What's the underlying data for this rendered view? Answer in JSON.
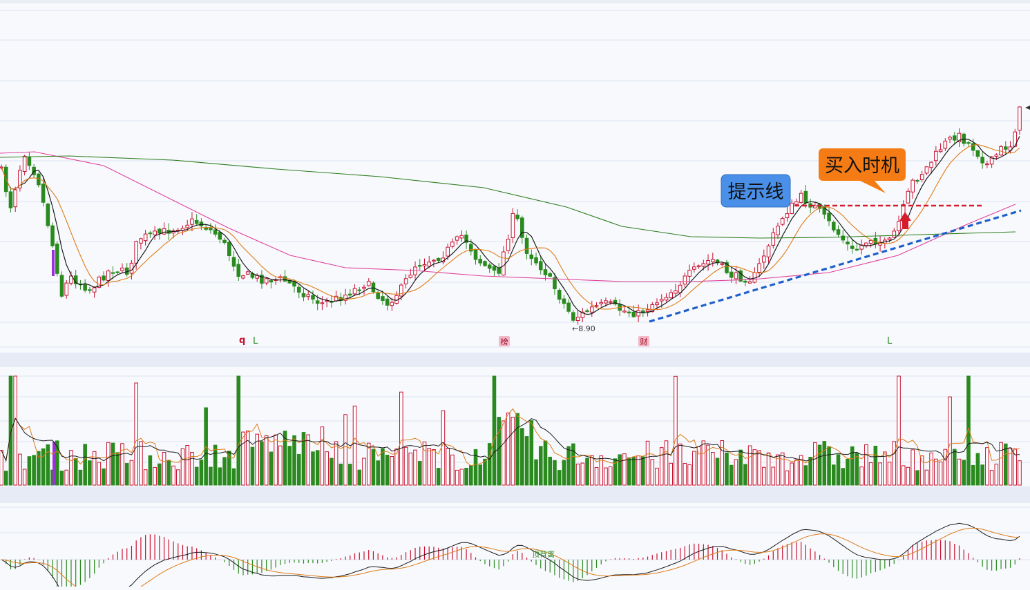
{
  "colors": {
    "up": "#c8102e",
    "down": "#2a8a1f",
    "ma_short": "#1a1a1a",
    "ma_mid": "#e07b14",
    "ma_long": "#e0409a",
    "ma_very_long": "#2e7d1e",
    "highlight_purple": "#9b30d9",
    "trend_blue": "#1f5fc9",
    "resistance_red": "#d41c2c",
    "callout_blue": "#4a90e8",
    "callout_orange": "#f57c14",
    "grid": "#dde3ef",
    "separator": "#e6ebf5"
  },
  "annotations": {
    "hint_line_label": "提示线",
    "buy_timing_label": "买入时机",
    "low_price_label": "←8.90",
    "macd_divergence_label": "顶背离",
    "marker_q": "q",
    "marker_l1": "L",
    "marker_bang": "榜",
    "marker_cai": "财",
    "marker_l2": "L"
  },
  "chart_data": [
    {
      "type": "candlestick",
      "panel": "price",
      "candle_count": 220,
      "low_value": 8.9,
      "moving_averages": [
        "MA5",
        "MA10",
        "MA60",
        "MA250"
      ],
      "overlays": [
        "ascending trend line",
        "horizontal hint line at prior high",
        "buy signal arrow"
      ]
    },
    {
      "type": "bar",
      "panel": "volume",
      "series": [
        "volume bars",
        "volume MA5",
        "volume MA10"
      ]
    },
    {
      "type": "bar",
      "panel": "macd",
      "series": [
        "MACD histogram",
        "DIF",
        "DEA"
      ]
    }
  ]
}
